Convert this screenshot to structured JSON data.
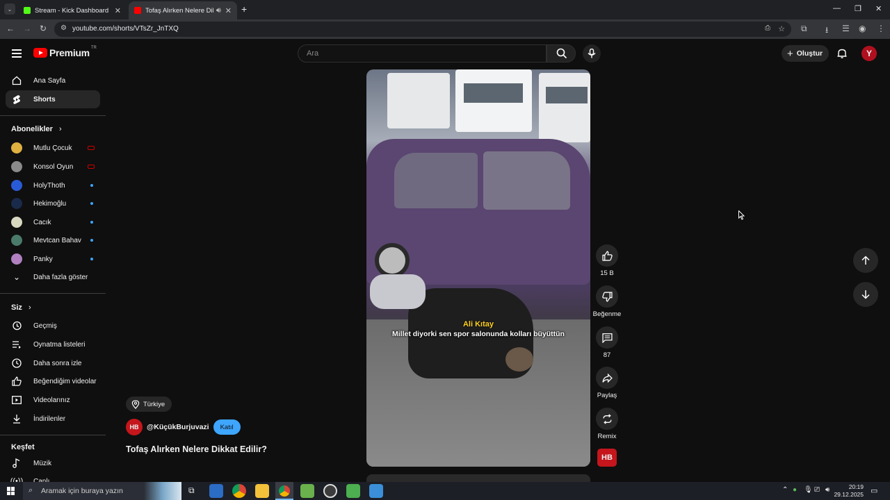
{
  "browser": {
    "tabs": [
      {
        "title": "Stream - Kick Dashboard",
        "favicon_color": "#53fc18"
      },
      {
        "title": "Tofaş Alırken Nelere Dikkat",
        "favicon_color": "#ff0000"
      }
    ],
    "url": "youtube.com/shorts/VTsZr_JnTXQ"
  },
  "header": {
    "logo_text": "Premium",
    "logo_badge": "TR",
    "search_placeholder": "Ara",
    "create_label": "Oluştur"
  },
  "sidebar": {
    "main": [
      {
        "label": "Ana Sayfa",
        "icon": "home-icon"
      },
      {
        "label": "Shorts",
        "icon": "shorts-icon",
        "active": true
      }
    ],
    "subscriptions_title": "Abonelikler",
    "subscriptions": [
      {
        "label": "Mutlu Çocuk",
        "status": "live",
        "color": "#e0b040"
      },
      {
        "label": "Konsol Oyun",
        "status": "live",
        "color": "#8a8a8a"
      },
      {
        "label": "HolyThoth",
        "status": "new",
        "color": "#2a5bd7"
      },
      {
        "label": "Hekimoğlu",
        "status": "new",
        "color": "#1a2a4a"
      },
      {
        "label": "Cacık",
        "status": "new",
        "color": "#d8d8c0"
      },
      {
        "label": "Mevtcan Bahav",
        "status": "new",
        "color": "#4a7a6a"
      },
      {
        "label": "Panky",
        "status": "new",
        "color": "#b080c0"
      }
    ],
    "show_more": "Daha fazla göster",
    "you_title": "Siz",
    "you_items": [
      {
        "label": "Geçmiş",
        "icon": "history-icon"
      },
      {
        "label": "Oynatma listeleri",
        "icon": "playlist-icon"
      },
      {
        "label": "Daha sonra izle",
        "icon": "watch-later-icon"
      },
      {
        "label": "Beğendiğim videolar",
        "icon": "like-icon"
      },
      {
        "label": "Videolarınız",
        "icon": "your-videos-icon"
      },
      {
        "label": "İndirilenler",
        "icon": "download-icon"
      }
    ],
    "explore_title": "Keşfet",
    "explore_items": [
      {
        "label": "Müzik",
        "icon": "music-icon"
      },
      {
        "label": "Canlı",
        "icon": "live-icon"
      }
    ]
  },
  "video": {
    "caption_name": "Ali Kıtay",
    "caption_text": "Millet diyorki sen spor salonunda kolları büyüttün",
    "location": "Türkiye",
    "channel_initials": "HB",
    "channel": "@KüçükBurjuvazi",
    "join_label": "Katıl",
    "title": "Tofaş Alırken Nelere Dikkat Edilir?"
  },
  "actions": {
    "likes": "15 B",
    "dislike_label": "Beğenme",
    "comments": "87",
    "share_label": "Paylaş",
    "remix_label": "Remix"
  },
  "taskbar": {
    "search_placeholder": "Aramak için buraya yazın",
    "time": "20:19",
    "date": "29.12.2025"
  }
}
